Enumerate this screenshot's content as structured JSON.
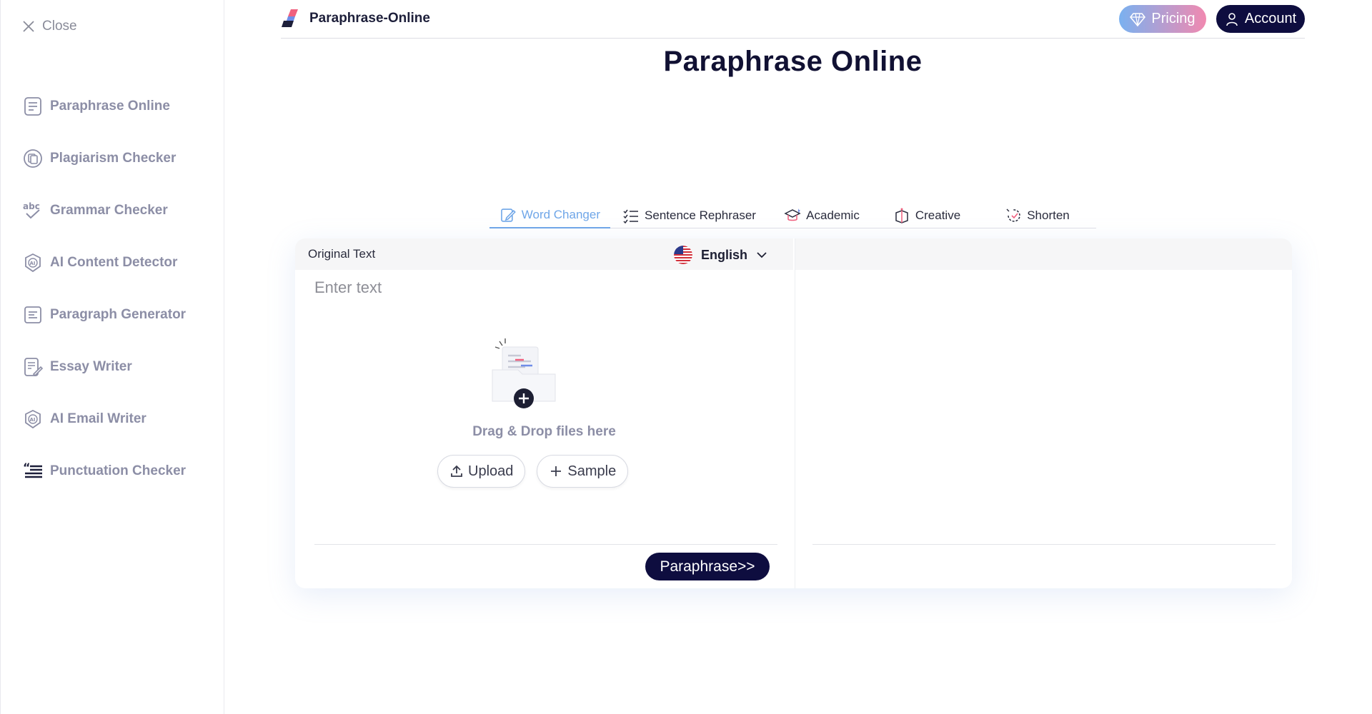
{
  "sidebar": {
    "close_label": "Close",
    "items": [
      {
        "label": "Paraphrase Online",
        "icon": "document-lines-icon"
      },
      {
        "label": "Plagiarism Checker",
        "icon": "copy-circle-icon"
      },
      {
        "label": "Grammar Checker",
        "icon": "abc-check-icon"
      },
      {
        "label": "AI Content Detector",
        "icon": "ai-badge-icon"
      },
      {
        "label": "Paragraph Generator",
        "icon": "paragraph-icon"
      },
      {
        "label": "Essay Writer",
        "icon": "document-pen-icon"
      },
      {
        "label": "AI Email Writer",
        "icon": "ai-badge-icon"
      },
      {
        "label": "Punctuation Checker",
        "icon": "quote-lines-icon"
      }
    ]
  },
  "header": {
    "brand": "Paraphrase-Online",
    "pricing_label": "Pricing",
    "account_label": "Account"
  },
  "page": {
    "title": "Paraphrase Online"
  },
  "tabs": [
    {
      "label": "Word Changer",
      "active": true
    },
    {
      "label": "Sentence Rephraser",
      "active": false
    },
    {
      "label": "Academic",
      "active": false
    },
    {
      "label": "Creative",
      "active": false
    },
    {
      "label": "Shorten",
      "active": false
    }
  ],
  "editor": {
    "original_label": "Original Text",
    "language": "English",
    "placeholder": "Enter text",
    "drop_text": "Drag & Drop files here",
    "upload_label": "Upload",
    "sample_label": "Sample",
    "paraphrase_label": "Paraphrase>>"
  },
  "colors": {
    "accent": "#6fa6e8",
    "dark_button": "#0e0d3f",
    "sidebar_text": "#8c8ea6"
  }
}
